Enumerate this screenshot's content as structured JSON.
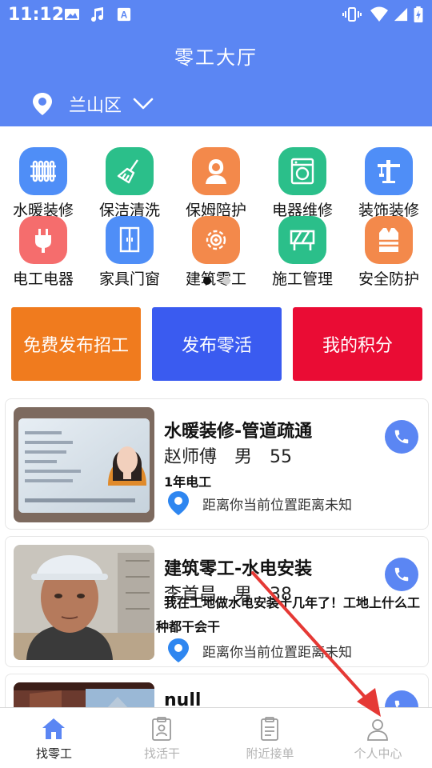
{
  "status_bar": {
    "time": "11:12"
  },
  "header": {
    "title": "零工大厅",
    "location": "兰山区"
  },
  "categories": [
    {
      "label": "水暖装修",
      "icon": "radiator-icon",
      "color": "#4f8ef7"
    },
    {
      "label": "保洁清洗",
      "icon": "broom-icon",
      "color": "#2bbf8a"
    },
    {
      "label": "保姆陪护",
      "icon": "nanny-icon",
      "color": "#f3894b"
    },
    {
      "label": "电器维修",
      "icon": "washing-machine-icon",
      "color": "#2bbf8a"
    },
    {
      "label": "装饰装修",
      "icon": "crane-icon",
      "color": "#4f8ef7"
    },
    {
      "label": "电工电器",
      "icon": "plug-icon",
      "color": "#f56d6d"
    },
    {
      "label": "家具门窗",
      "icon": "wardrobe-icon",
      "color": "#4f8ef7"
    },
    {
      "label": "建筑零工",
      "icon": "gear-icon",
      "color": "#f3894b"
    },
    {
      "label": "施工管理",
      "icon": "construction-icon",
      "color": "#2bbf8a"
    },
    {
      "label": "安全防护",
      "icon": "safety-vest-icon",
      "color": "#f3894b"
    }
  ],
  "actions": [
    {
      "label": "免费发布招工",
      "color": "#f07b1e"
    },
    {
      "label": "发布零活",
      "color": "#3a5bf0"
    },
    {
      "label": "我的积分",
      "color": "#ea0c34"
    }
  ],
  "cards": [
    {
      "title": "水暖装修-管道疏通",
      "name": "赵师傅",
      "gender": "男",
      "age": "55",
      "desc": "1年电工",
      "distance": "距离你当前位置距离未知"
    },
    {
      "title": "建筑零工-水电安装",
      "name": "李首昌",
      "gender": "男",
      "age": "38",
      "desc": "我在工地做水电安装十几年了！工地上什么工种都干会干",
      "distance": "距离你当前位置距离未知"
    },
    {
      "title": "null"
    }
  ],
  "bottom_nav": [
    {
      "label": "找零工",
      "icon": "home-icon",
      "active": true
    },
    {
      "label": "找活干",
      "icon": "clipboard-user-icon",
      "active": false
    },
    {
      "label": "附近接单",
      "icon": "document-icon",
      "active": false
    },
    {
      "label": "个人中心",
      "icon": "user-icon",
      "active": false
    }
  ],
  "colors": {
    "primary": "#5b86f3",
    "nav_active": "#5b86f3",
    "nav_inactive": "#b3b3b3",
    "annotation_arrow": "#e53935"
  }
}
